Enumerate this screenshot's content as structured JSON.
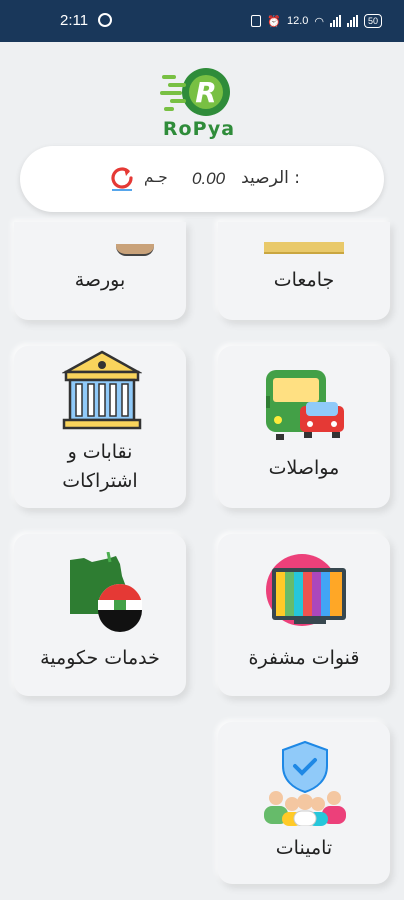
{
  "status": {
    "time": "2:11",
    "battery": "50",
    "speed": "12.0"
  },
  "logo": {
    "text": "RoPya"
  },
  "balance": {
    "label": "الرصيد :",
    "value": "0.00",
    "currency": "جـم"
  },
  "services": [
    {
      "label": "جامعات",
      "icon": "university-icon"
    },
    {
      "label": "بورصة",
      "icon": "stock-exchange-icon"
    },
    {
      "label": "مواصلات",
      "icon": "transport-icon"
    },
    {
      "label": "نقابات و\nاشتراكات",
      "icon": "syndicate-building-icon"
    },
    {
      "label": "قنوات مشفرة",
      "icon": "encrypted-tv-icon"
    },
    {
      "label": "خدمات حكومية",
      "icon": "egypt-government-icon"
    },
    {
      "label": "تامينات",
      "icon": "insurance-icon"
    }
  ],
  "colors": {
    "statusbar": "#19375a",
    "brand_green": "#2f8c3a",
    "refresh_red": "#e53935"
  }
}
